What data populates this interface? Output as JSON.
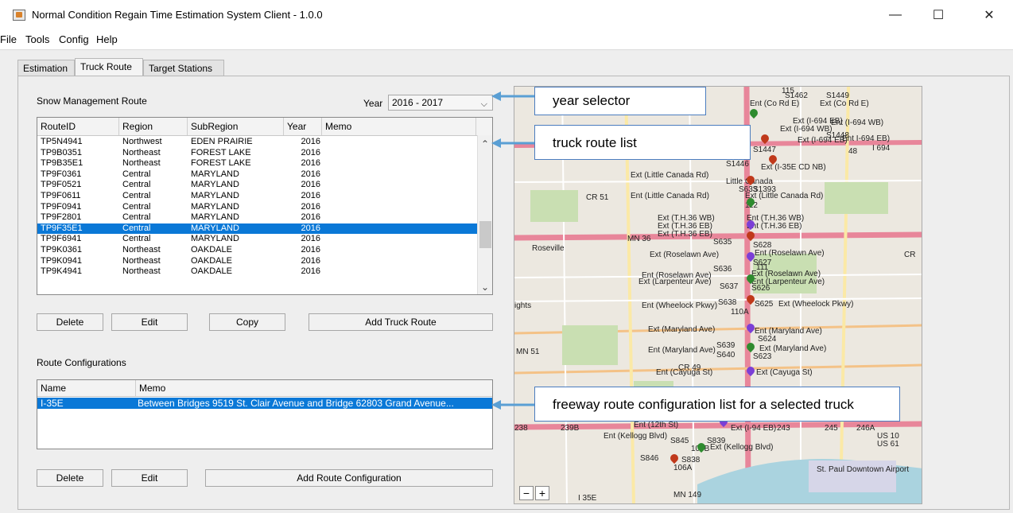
{
  "window": {
    "title": "Normal Condition Regain Time Estimation System Client - 1.0.0",
    "minimize": "—",
    "maximize": "☐",
    "close": "✕"
  },
  "menu": [
    "File",
    "Tools",
    "Config",
    "Help"
  ],
  "tabs": [
    "Estimation",
    "Truck Route",
    "Target Stations"
  ],
  "snow_route": {
    "title": "Snow Management Route",
    "year_label": "Year",
    "year_value": "2016 - 2017",
    "columns": [
      "RouteID",
      "Region",
      "SubRegion",
      "Year",
      "Memo"
    ],
    "rows": [
      [
        "TP5N4941",
        "Northwest",
        "EDEN PRAIRIE",
        "2016",
        ""
      ],
      [
        "TP9B0351",
        "Northeast",
        "FOREST LAKE",
        "2016",
        ""
      ],
      [
        "TP9B35E1",
        "Northeast",
        "FOREST LAKE",
        "2016",
        ""
      ],
      [
        "TP9F0361",
        "Central",
        "MARYLAND",
        "2016",
        ""
      ],
      [
        "TP9F0521",
        "Central",
        "MARYLAND",
        "2016",
        ""
      ],
      [
        "TP9F0611",
        "Central",
        "MARYLAND",
        "2016",
        ""
      ],
      [
        "TP9F0941",
        "Central",
        "MARYLAND",
        "2016",
        ""
      ],
      [
        "TP9F2801",
        "Central",
        "MARYLAND",
        "2016",
        ""
      ],
      [
        "TP9F35E1",
        "Central",
        "MARYLAND",
        "2016",
        ""
      ],
      [
        "TP9F6941",
        "Central",
        "MARYLAND",
        "2016",
        ""
      ],
      [
        "TP9K0361",
        "Northeast",
        "OAKDALE",
        "2016",
        ""
      ],
      [
        "TP9K0941",
        "Northeast",
        "OAKDALE",
        "2016",
        ""
      ],
      [
        "TP9K4941",
        "Northeast",
        "OAKDALE",
        "2016",
        ""
      ]
    ],
    "selected_row": 8,
    "buttons": [
      "Delete",
      "Edit",
      "Copy",
      "Add Truck Route"
    ]
  },
  "route_config": {
    "title": "Route Configurations",
    "columns": [
      "Name",
      "Memo"
    ],
    "rows": [
      [
        "I-35E",
        "Between Bridges 9519 St. Clair Avenue and Bridge 62803 Grand Avenue..."
      ]
    ],
    "buttons": [
      "Delete",
      "Edit",
      "Add  Route Configuration"
    ]
  },
  "callouts": {
    "year": "year selector",
    "truck": "truck route list",
    "config": "freeway route configuration list for a selected truck"
  },
  "map_labels": [
    "S1462",
    "S1449",
    "Ent (Co Rd E)",
    "Ext (Co Rd E)",
    "Ext (I-694 EB)",
    "Ent (I-694 WB)",
    "Ext (I-694 WB)",
    "S1448",
    "Ext (I-694 EB)",
    "Ent I-694 EB)",
    "S1447",
    "S1446",
    "Ext (I-35E CD NB)",
    "Ext (Little Canada Rd)",
    "Little Canada",
    "S633",
    "S1393",
    "Ent (Little Canada Rd)",
    "Ext (Little Canada Rd)",
    "Ext (T.H.36 WB)",
    "Ent (T.H.36 WB)",
    "Ext (T.H.36 EB)",
    "Ent (T.H.36 EB)",
    "Ext (T.H.36 EB)",
    "S635",
    "S628",
    "Roseville",
    "Ext (Roselawn Ave)",
    "Ent (Roselawn Ave)",
    "S627",
    "S636",
    "Ent (Roselawn Ave)",
    "Ext (Roselawn Ave)",
    "Ext (Larpenteur Ave)",
    "Ent (Larpenteur Ave)",
    "S637",
    "S626",
    "Ent (Wheelock Pkwy)",
    "S638",
    "S625",
    "Ext (Wheelock Pkwy)",
    "Ext (Maryland Ave)",
    "Ent (Maryland Ave)",
    "S624",
    "Ent (Maryland Ave)",
    "S639",
    "Ext (Maryland Ave)",
    "S640",
    "S623",
    "Ent (Cayuga St)",
    "Ext (Cayuga St)",
    "Ent (12th St)",
    "Ext (I-94 EB)",
    "Ent (Kellogg Blvd)",
    "S845",
    "S839",
    "Ext (Kellogg Blvd)",
    "S846",
    "S838",
    "CR 51",
    "MN 36",
    "MN 51",
    "CR 49",
    "I 694",
    "US 10",
    "US 61",
    "I 35E",
    "MN 149",
    "St. Paul Downtown Airport",
    "112",
    "115",
    "111",
    "110A",
    "106B",
    "106A",
    "238",
    "239B",
    "243",
    "245",
    "246A",
    "48",
    "CR",
    "ights"
  ]
}
